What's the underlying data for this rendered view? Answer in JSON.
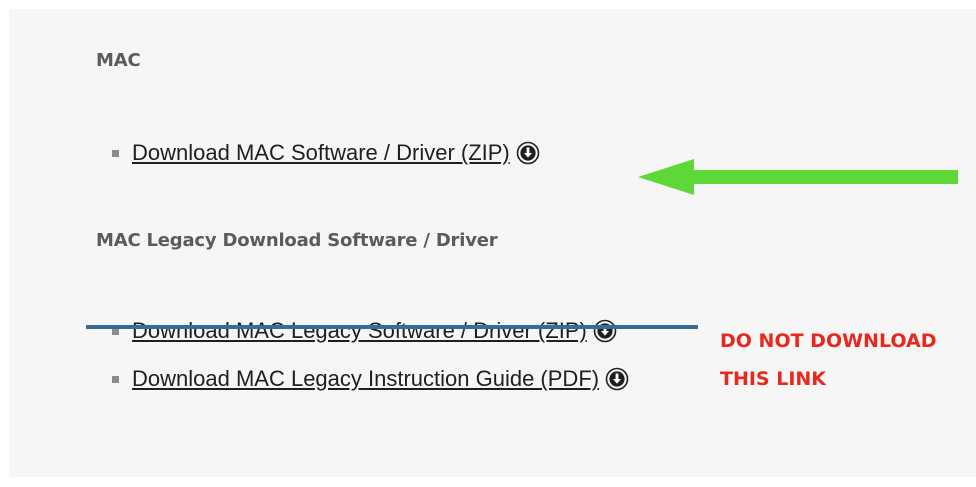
{
  "colors": {
    "panel_background": "#f6f6f6",
    "heading_text": "#5b5b5b",
    "link_text": "#1f1f1f",
    "strikethrough_line": "#356c98",
    "warning_text": "#e8281c",
    "arrow": "#5dd837"
  },
  "mac_section": {
    "heading": "MAC",
    "links": [
      {
        "label": "Download MAC Software / Driver (ZIP)",
        "icon": "download-circle-icon"
      }
    ]
  },
  "legacy_section": {
    "heading": "MAC Legacy Download Software / Driver",
    "links": [
      {
        "label": "Download MAC Legacy Software / Driver (ZIP)",
        "icon": "download-circle-icon",
        "struck_through": true
      },
      {
        "label": "Download MAC Legacy Instruction Guide (PDF)",
        "icon": "download-circle-icon"
      }
    ]
  },
  "annotations": {
    "arrow": {
      "icon": "left-arrow-icon",
      "points_to": "mac_section.links.0"
    },
    "warning_line1": "DO NOT DOWNLOAD",
    "warning_line2": "THIS LINK"
  }
}
